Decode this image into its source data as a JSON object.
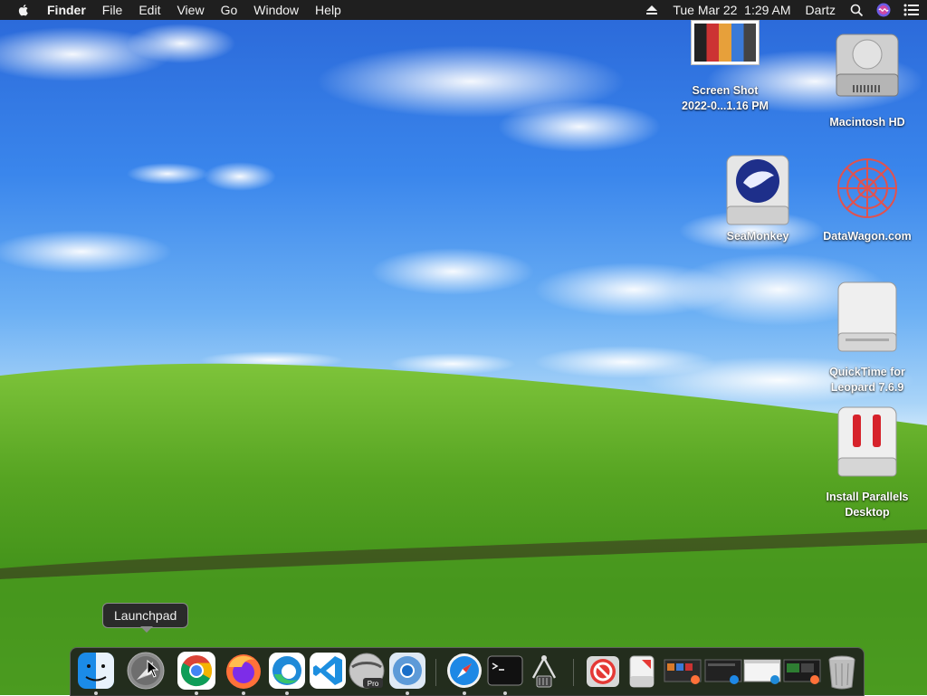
{
  "menubar": {
    "app": "Finder",
    "menus": [
      "File",
      "Edit",
      "View",
      "Go",
      "Window",
      "Help"
    ],
    "clock": "Tue Mar 22  1:29 AM",
    "user": "Dartz",
    "icons": [
      "eject-icon",
      "search-icon",
      "siri-icon",
      "control-center-icon"
    ]
  },
  "desktop": {
    "items": [
      {
        "label": "Screen Shot\n2022-0...1.16 PM",
        "icon": "screenshot-thumbnail"
      },
      {
        "label": "Macintosh HD",
        "icon": "hard-drive-icon"
      },
      {
        "label": "SeaMonkey",
        "icon": "seamonkey-disk-icon"
      },
      {
        "label": "DataWagon.com",
        "icon": "datawagon-icon"
      },
      {
        "label": "QuickTime for\nLeopard 7.6.9",
        "icon": "disk-image-icon"
      },
      {
        "label": "Install Parallels\nDesktop",
        "icon": "parallels-disk-icon"
      }
    ]
  },
  "tooltip": "Launchpad",
  "dock": {
    "apps": [
      "Finder",
      "Launchpad",
      "Google Chrome",
      "Firefox",
      "Microsoft Edge",
      "Visual Studio Code",
      "Disk Utility Pro",
      "Chromium",
      "Safari",
      "Terminal",
      "System Information",
      "No Entry",
      "Installer",
      "Window 1",
      "Window 2",
      "Window 3",
      "Window 4",
      "Trash"
    ]
  },
  "colors": {
    "menubar": "#1f1f1f",
    "dock": "#1e1e1e",
    "sky": "#3a86ec",
    "grass": "#4f9a1e"
  }
}
